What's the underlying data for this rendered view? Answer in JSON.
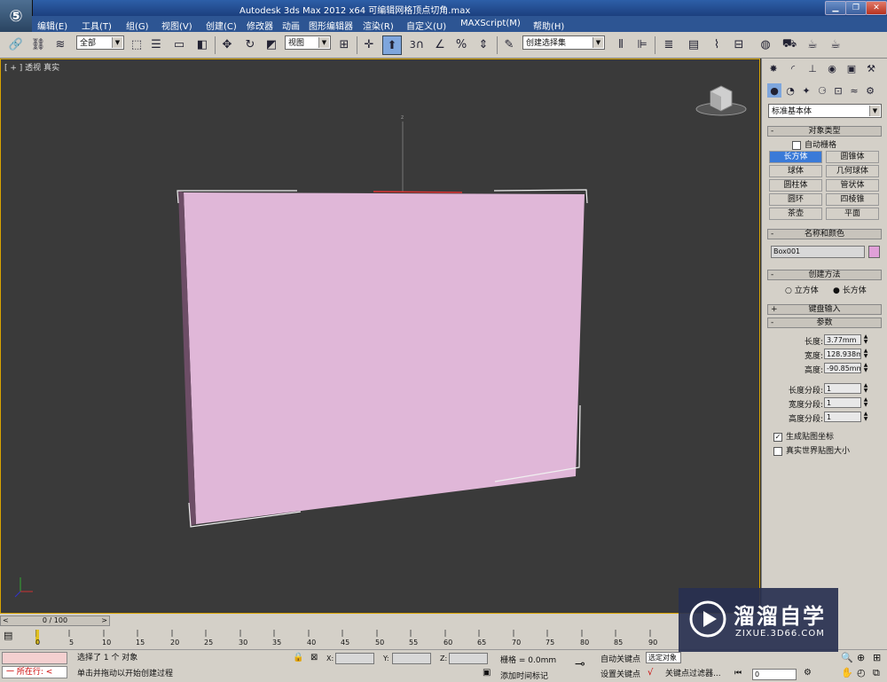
{
  "app": {
    "title": "Autodesk 3ds Max  2012 x64       可编辑网格顶点切角.max"
  },
  "menu": [
    "编辑(E)",
    "工具(T)",
    "组(G)",
    "视图(V)",
    "创建(C)",
    "修改器",
    "动画",
    "图形编辑器",
    "渲染(R)",
    "自定义(U)",
    "MAXScript(M)",
    "帮助(H)"
  ],
  "toolbar": {
    "selection_filter": "全部",
    "ref_coord": "视图",
    "snap_3": "3",
    "named_selection": "创建选择集"
  },
  "viewport": {
    "label": "[ + ] 透视 ] 真实 ]",
    "label_parts": [
      "[ + ]",
      "透视",
      "真实"
    ],
    "axis_z": "z",
    "object_color": "#e0b7d8"
  },
  "panel": {
    "category_dropdown": "标准基本体",
    "object_type": {
      "title": "对象类型",
      "autogrid": "自动栅格",
      "buttons": [
        "长方体",
        "圆锥体",
        "球体",
        "几何球体",
        "圆柱体",
        "管状体",
        "圆环",
        "四棱锥",
        "茶壶",
        "平面"
      ],
      "active": "长方体"
    },
    "name_color": {
      "title": "名称和颜色",
      "name": "Box001",
      "color": "#e0a0d8"
    },
    "creation_method": {
      "title": "创建方法",
      "option1": "立方体",
      "option2": "长方体",
      "selected": "长方体"
    },
    "keyboard_entry": {
      "title": "键盘输入"
    },
    "params": {
      "title": "参数",
      "length_label": "长度:",
      "length": "3.77mm",
      "width_label": "宽度:",
      "width": "128.938m",
      "height_label": "高度:",
      "height": "-90.85mm",
      "length_segs_label": "长度分段:",
      "length_segs": "1",
      "width_segs_label": "宽度分段:",
      "width_segs": "1",
      "height_segs_label": "高度分段:",
      "height_segs": "1",
      "gen_map_coords": "生成贴图坐标",
      "real_world_map": "真实世界贴图大小"
    }
  },
  "timeline": {
    "frame": "0 / 100",
    "ticks": [
      "0",
      "5",
      "10",
      "15",
      "20",
      "25",
      "30",
      "35",
      "40",
      "45",
      "50",
      "55",
      "60",
      "65",
      "70",
      "75",
      "80",
      "85",
      "90"
    ]
  },
  "status": {
    "maxscript": "所在行:",
    "msg1": "选择了 1 个 对象",
    "msg2": "单击并拖动以开始创建过程",
    "x_label": "X:",
    "y_label": "Y:",
    "z_label": "Z:",
    "grid": "栅格 = 0.0mm",
    "add_time_tag": "添加时间标记",
    "auto_key": "自动关键点",
    "set_key": "设置关键点",
    "selected_obj": "选定对象",
    "key_filters": "关键点过滤器...",
    "frame_field": "0"
  },
  "watermark": {
    "brand": "溜溜自学",
    "url": "ZIXUE.3D66.COM"
  }
}
